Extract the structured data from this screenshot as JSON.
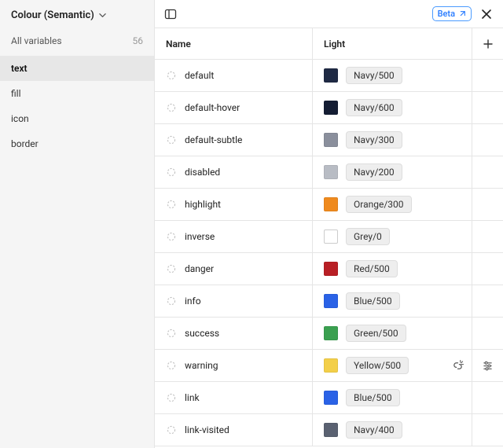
{
  "header": {
    "collection_name": "Colour (Semantic)"
  },
  "sidebar": {
    "summary_label": "All variables",
    "summary_count": "56",
    "groups": [
      {
        "label": "text",
        "active": true
      },
      {
        "label": "fill",
        "active": false
      },
      {
        "label": "icon",
        "active": false
      },
      {
        "label": "border",
        "active": false
      }
    ]
  },
  "topbar": {
    "beta_label": "Beta"
  },
  "table": {
    "col_name": "Name",
    "col_light": "Light",
    "rows": [
      {
        "name": "default",
        "color": "#1f2a44",
        "alias": "Navy/500"
      },
      {
        "name": "default-hover",
        "color": "#141d33",
        "alias": "Navy/600"
      },
      {
        "name": "default-subtle",
        "color": "#8a8f9c",
        "alias": "Navy/300"
      },
      {
        "name": "disabled",
        "color": "#b8bcc4",
        "alias": "Navy/200"
      },
      {
        "name": "highlight",
        "color": "#ef8a1e",
        "alias": "Orange/300"
      },
      {
        "name": "inverse",
        "color": "#ffffff",
        "alias": "Grey/0"
      },
      {
        "name": "danger",
        "color": "#b81f25",
        "alias": "Red/500"
      },
      {
        "name": "info",
        "color": "#2a62e6",
        "alias": "Blue/500"
      },
      {
        "name": "success",
        "color": "#3aa050",
        "alias": "Green/500"
      },
      {
        "name": "warning",
        "color": "#f3cf49",
        "alias": "Yellow/500",
        "editing": true
      },
      {
        "name": "link",
        "color": "#2a62e6",
        "alias": "Blue/500"
      },
      {
        "name": "link-visited",
        "color": "#5a6171",
        "alias": "Navy/400"
      }
    ]
  }
}
